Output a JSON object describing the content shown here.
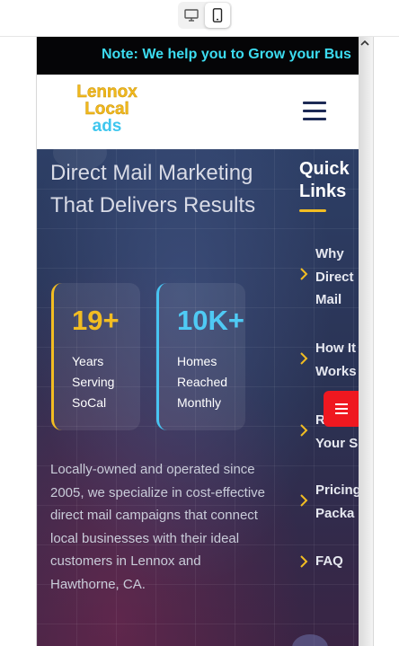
{
  "toolbar": {
    "desktop_icon": "desktop-icon",
    "mobile_icon": "mobile-phone-icon"
  },
  "ticker": {
    "text": "Note: We help you to Grow your Bus"
  },
  "header": {
    "logo_line1": "Lennox",
    "logo_line2": "Local",
    "logo_line3": "ads",
    "menu_icon": "hamburger-menu-icon"
  },
  "hero": {
    "title": "Direct Mail Marketing That Delivers Results",
    "stats": [
      {
        "value": "19+",
        "label": "Years Serving SoCal"
      },
      {
        "value": "10K+",
        "label": "Homes Reached Monthly"
      }
    ],
    "description": "Locally-owned and operated since 2005, we specialize in cost-effective direct mail campaigns that connect local businesses with their ideal customers in Lennox and Hawthorne, CA."
  },
  "quick_links": {
    "title": "Quick Links",
    "items": [
      {
        "label": "Why\nDirect\nMail"
      },
      {
        "label": "How It\nWorks"
      },
      {
        "label": "R\nYour S"
      },
      {
        "label": "Pricing\nPacka"
      },
      {
        "label": "FAQ"
      }
    ]
  },
  "floating_button": {
    "icon": "list-menu-icon"
  },
  "colors": {
    "brand_yellow": "#f2bd22",
    "brand_cyan": "#3cdcf0",
    "accent_red": "#ef1820",
    "ticker_bg": "#050507"
  }
}
